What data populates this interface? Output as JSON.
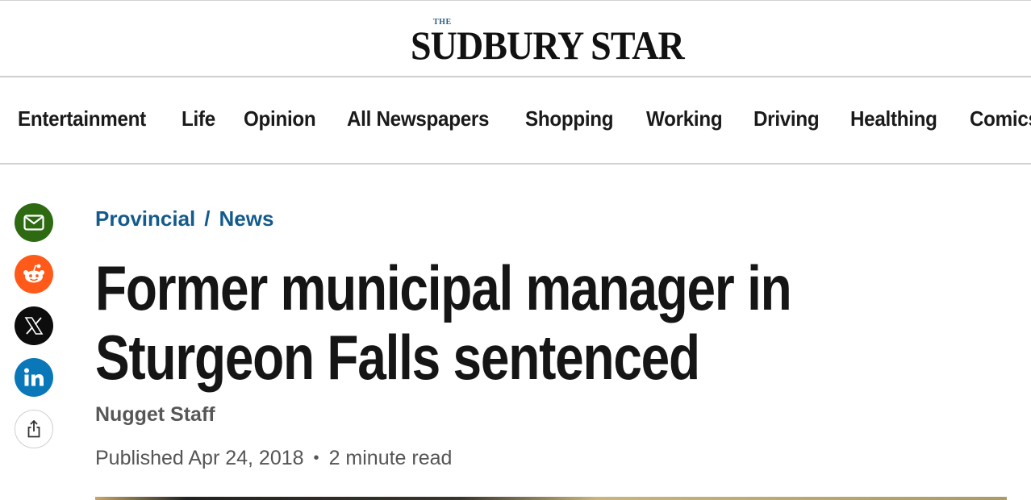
{
  "logo": {
    "the": "THE",
    "name": "SUDBURY STAR"
  },
  "nav": {
    "items": [
      "Entertainment",
      "Life",
      "Opinion",
      "All Newspapers",
      "Shopping",
      "Working",
      "Driving",
      "Healthing",
      "Comics"
    ]
  },
  "share": {
    "buttons": [
      {
        "name": "email",
        "icon": "envelope-icon",
        "color": "#2e6a12"
      },
      {
        "name": "reddit",
        "icon": "reddit-icon",
        "color": "#ff5a1a"
      },
      {
        "name": "x",
        "icon": "x-icon",
        "color": "#0d0d0d"
      },
      {
        "name": "linkedin",
        "icon": "linkedin-icon",
        "color": "#0a78b8"
      },
      {
        "name": "more",
        "icon": "share-icon",
        "color": "#ffffff"
      }
    ]
  },
  "article": {
    "breadcrumb": {
      "section": "Provincial",
      "separator": "/",
      "subsection": "News"
    },
    "headline": "Former municipal manager in Sturgeon Falls sentenced",
    "author": "Nugget Staff",
    "published": "Published Apr 24, 2018",
    "dot": "•",
    "read_time": "2 minute read"
  },
  "colors": {
    "breadcrumb": "#135b8c",
    "headline": "#151515",
    "meta": "#555555"
  }
}
